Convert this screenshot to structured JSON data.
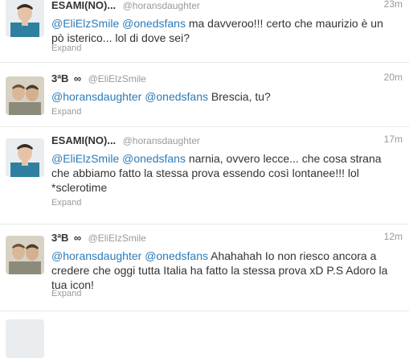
{
  "tweets": [
    {
      "fullname": "ESAMI(NO)...",
      "username": "@horansdaughter",
      "time": "23m",
      "mentions": [
        "@EliElzSmile",
        "@onedsfans"
      ],
      "body": " ma davveroo!!! certo che maurizio è un pò isterico... lol  di dove sei?",
      "expand": "Expand"
    },
    {
      "fullname": "3ªB",
      "verified": "∞",
      "username": "@EliElzSmile",
      "time": "20m",
      "mentions": [
        "@horansdaughter",
        "@onedsfans"
      ],
      "body": " Brescia, tu?",
      "expand": "Expand"
    },
    {
      "fullname": "ESAMI(NO)...",
      "username": "@horansdaughter",
      "time": "17m",
      "mentions": [
        "@EliElzSmile",
        "@onedsfans"
      ],
      "body": " narnia, ovvero lecce... che cosa strana che abbiamo fatto la stessa prova essendo così lontanee!!! lol *sclerotime",
      "expand": "Expand"
    },
    {
      "fullname": "3ªB",
      "verified": "∞",
      "username": "@EliElzSmile",
      "time": "12m",
      "mentions": [
        "@horansdaughter",
        "@onedsfans"
      ],
      "body": " Ahahahah Io non riesco ancora a credere che oggi tutta Italia ha fatto la stessa prova xD P.S Adoro la tua icon!",
      "expand": "Expand"
    }
  ],
  "colors": {
    "mention": "#2b7bb9",
    "muted": "#999999",
    "text": "#333333",
    "divider": "#e8e8e8"
  }
}
